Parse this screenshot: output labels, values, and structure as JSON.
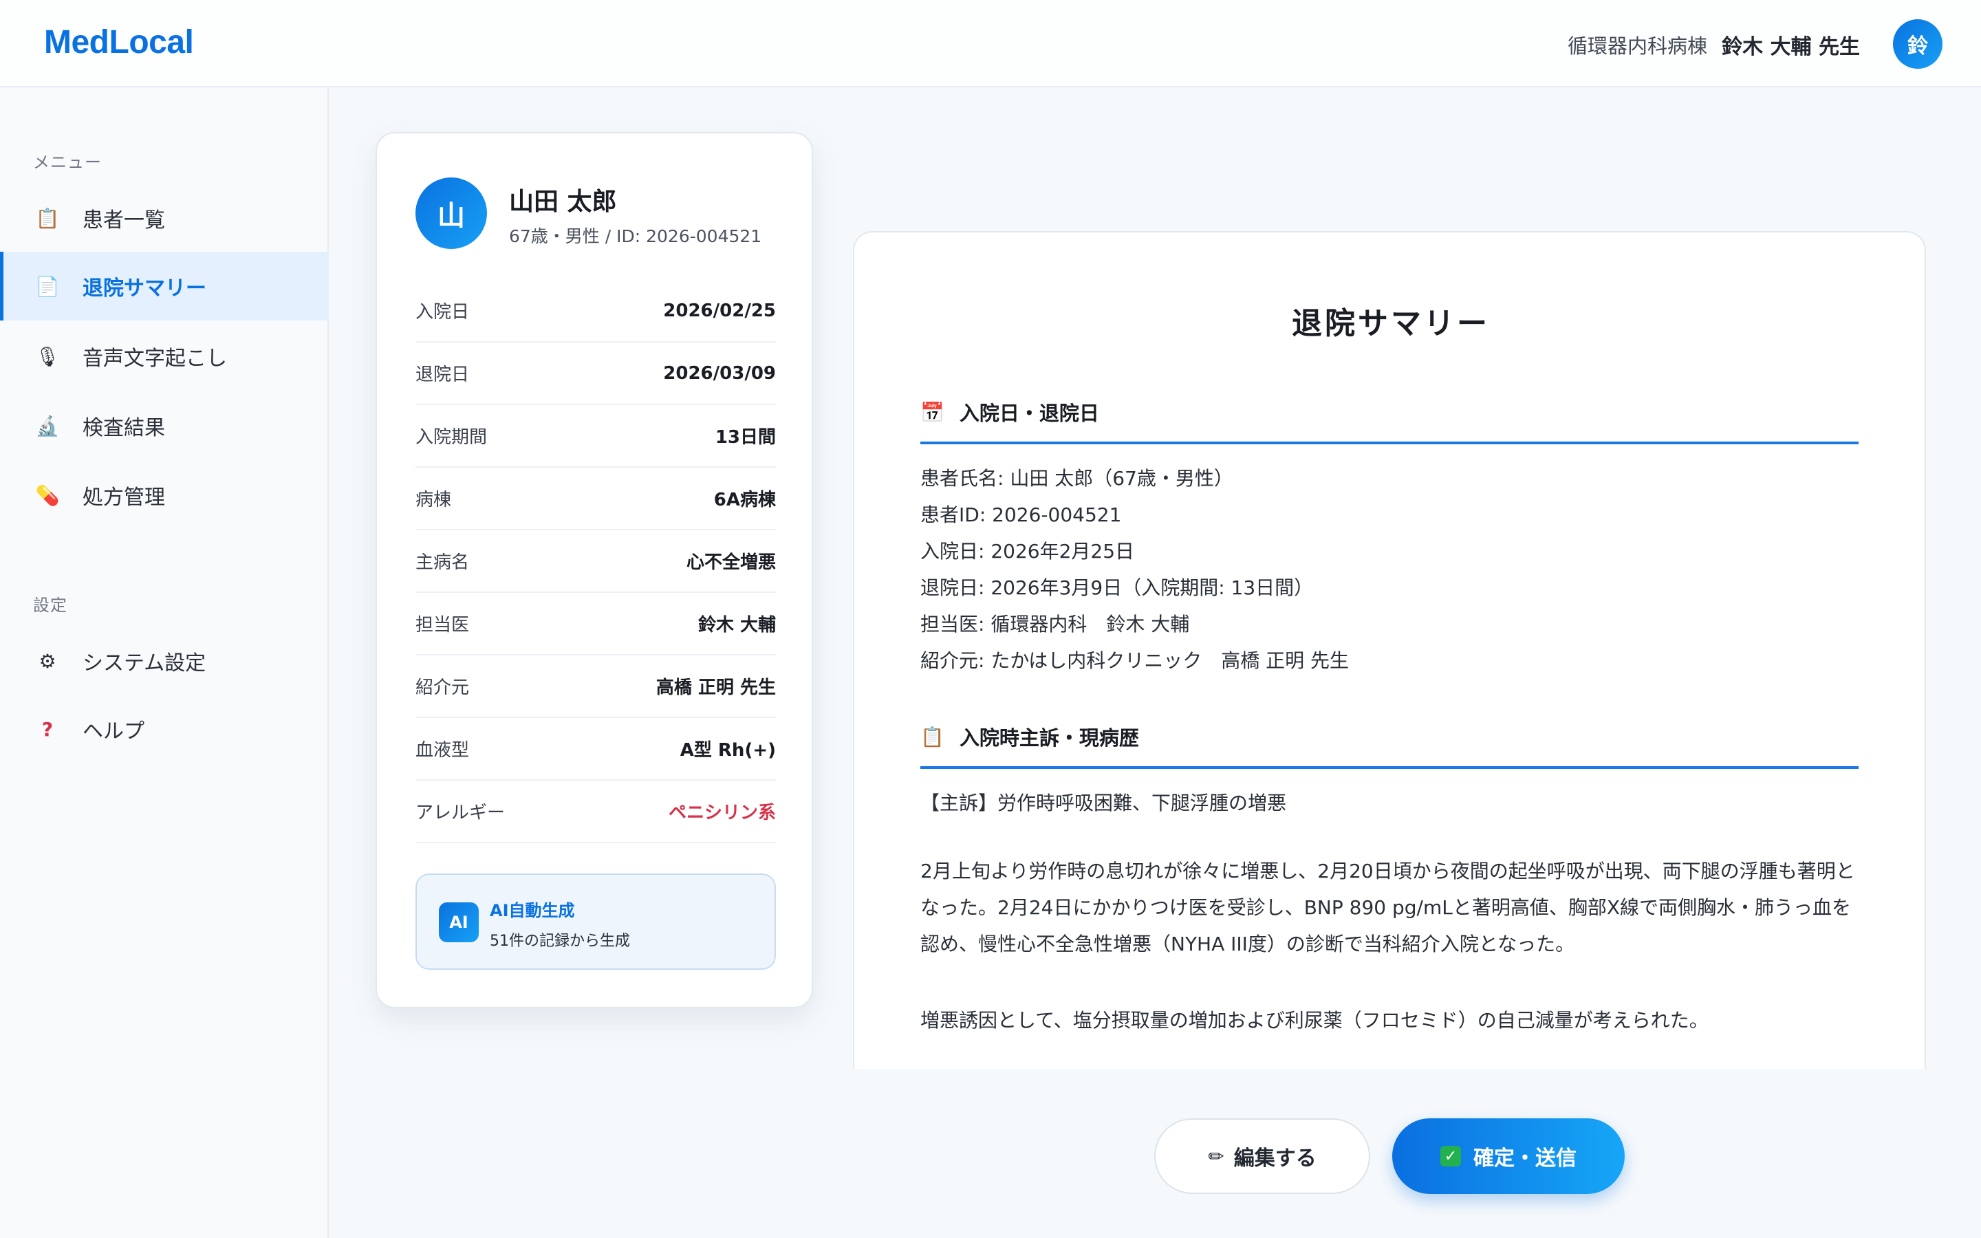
{
  "header": {
    "logo": "MedLocal",
    "ward": "循環器内科病棟",
    "doctor": "鈴木 大輔 先生",
    "avatar_initial": "鈴"
  },
  "sidebar": {
    "menu_label": "メニュー",
    "settings_label": "設定",
    "items": [
      {
        "label": "患者一覧",
        "icon": "clipboard-icon"
      },
      {
        "label": "退院サマリー",
        "icon": "document-icon"
      },
      {
        "label": "音声文字起こし",
        "icon": "microphone-icon"
      },
      {
        "label": "検査結果",
        "icon": "microscope-icon"
      },
      {
        "label": "処方管理",
        "icon": "pill-icon"
      }
    ],
    "settings_items": [
      {
        "label": "システム設定",
        "icon": "gear-icon"
      },
      {
        "label": "ヘルプ",
        "icon": "question-icon"
      }
    ],
    "active_index": 1
  },
  "patient": {
    "initial": "山",
    "name": "山田 太郎",
    "sub": "67歳・男性 / ID: 2026-004521",
    "rows": [
      {
        "k": "入院日",
        "v": "2026/02/25"
      },
      {
        "k": "退院日",
        "v": "2026/03/09"
      },
      {
        "k": "入院期間",
        "v": "13日間"
      },
      {
        "k": "病棟",
        "v": "6A病棟"
      },
      {
        "k": "主病名",
        "v": "心不全増悪"
      },
      {
        "k": "担当医",
        "v": "鈴木 大輔"
      },
      {
        "k": "紹介元",
        "v": "高橋 正明 先生"
      },
      {
        "k": "血液型",
        "v": "A型 Rh(+)"
      },
      {
        "k": "アレルギー",
        "v": "ペニシリン系"
      }
    ],
    "ai": {
      "badge": "AI",
      "title": "AI自動生成",
      "sub": "51件の記録から生成"
    }
  },
  "summary": {
    "title": "退院サマリー",
    "section1": {
      "icon": "calendar-icon",
      "heading": "入院日・退院日",
      "lines": [
        "患者氏名: 山田 太郎（67歳・男性）",
        "患者ID: 2026-004521",
        "入院日: 2026年2月25日",
        "退院日: 2026年3月9日（入院期間: 13日間）",
        "担当医: 循環器内科　鈴木 大輔",
        "紹介元: たかはし内科クリニック　高橋 正明 先生"
      ]
    },
    "section2": {
      "icon": "clipboard-icon",
      "heading": "入院時主訴・現病歴",
      "chief": "【主訴】労作時呼吸困難、下腿浮腫の増悪",
      "history": "2月上旬より労作時の息切れが徐々に増悪し、2月20日頃から夜間の起坐呼吸が出現、両下腿の浮腫も著明となった。2月24日にかかりつけ医を受診し、BNP 890 pg/mLと著明高値、胸部X線で両側胸水・肺うっ血を認め、慢性心不全急性増悪（NYHA III度）の診断で当科紹介入院となった。",
      "cause": "増悪誘因として、塩分摂取量の増加および利尿薬（フロセミド）の自己減量が考えられた。"
    }
  },
  "actions": {
    "edit_label": "編集する",
    "submit_label": "確定・送信"
  }
}
